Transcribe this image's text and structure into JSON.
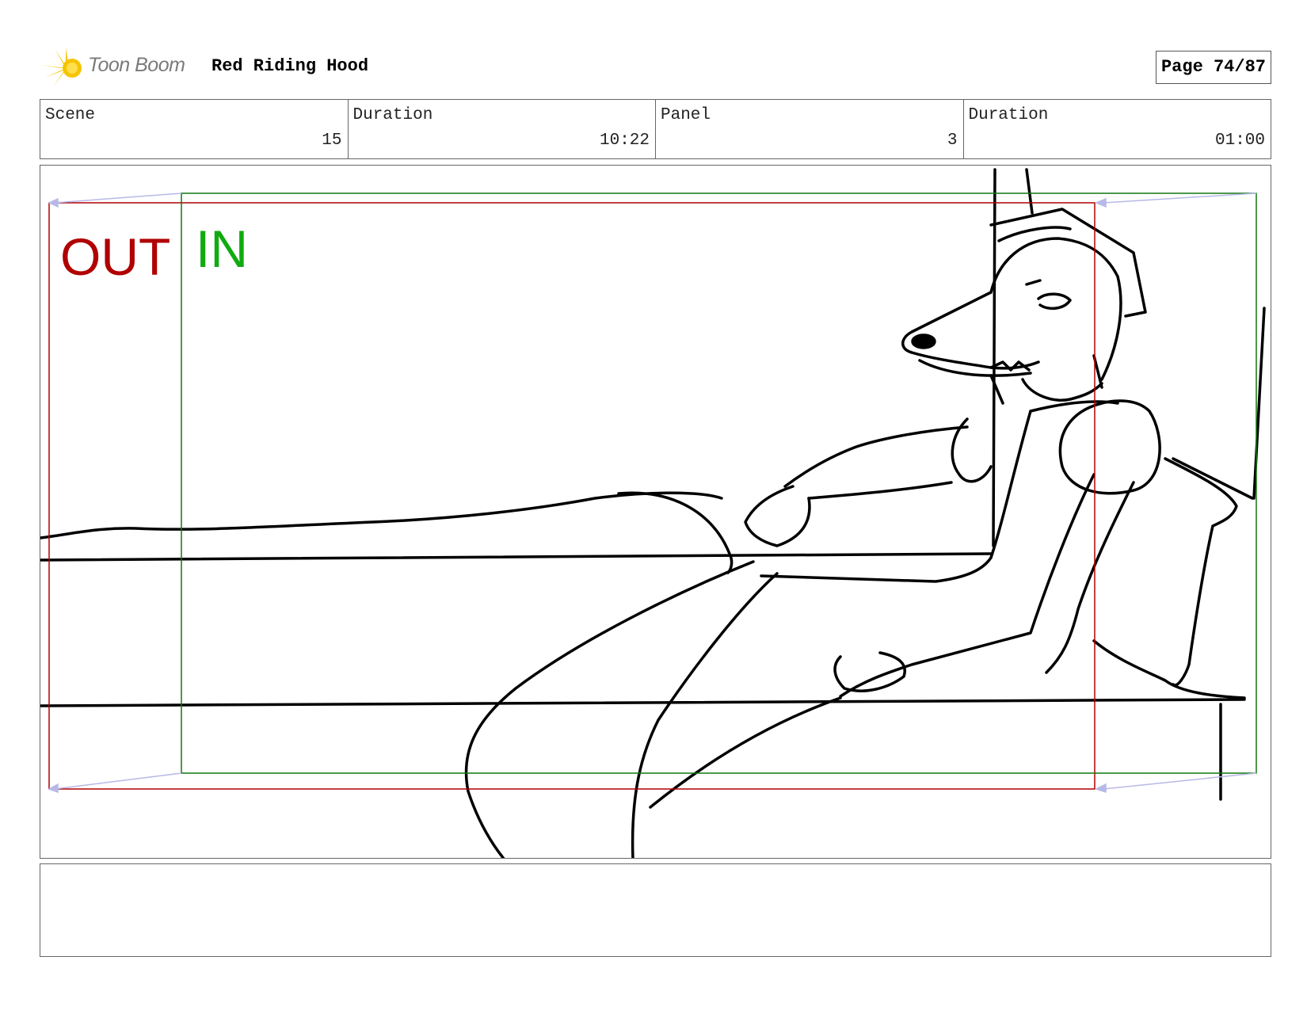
{
  "header": {
    "logo_text": "Toon Boom",
    "project_title": "Red Riding Hood",
    "page_indicator": "Page 74/87"
  },
  "info": {
    "scene_label": "Scene",
    "scene_value": "15",
    "scene_duration_label": "Duration",
    "scene_duration_value": "10:22",
    "panel_label": "Panel",
    "panel_value": "3",
    "panel_duration_label": "Duration",
    "panel_duration_value": "01:00"
  },
  "panel": {
    "camera_out_label": "OUT",
    "camera_in_label": "IN",
    "out_frame_color": "#b00000",
    "in_frame_color": "#11aa11"
  },
  "notes": {
    "text": ""
  }
}
